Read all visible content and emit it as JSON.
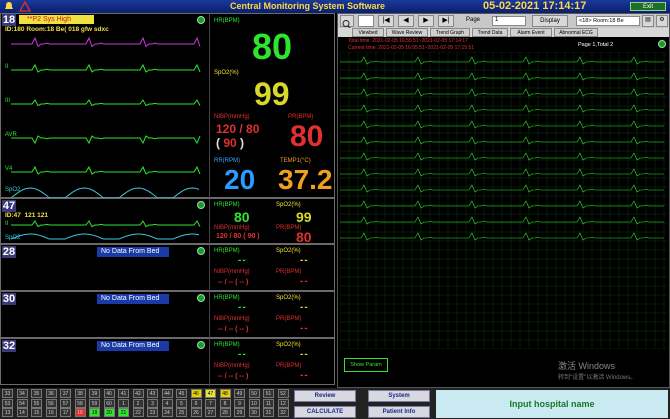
{
  "topbar": {
    "title": "Central Monitoring System Software",
    "datetime": "05-02-2021 17:14:17",
    "exit": "Exit"
  },
  "beds": [
    {
      "number": "18",
      "alarm": "**P2 Sys High",
      "info": "ID:180 Room:18 Be(",
      "name": "018 gfw sdxc",
      "leads": [
        "II",
        "III",
        "AVR",
        "V4"
      ],
      "spo2_wave": "SpO2",
      "hr_label": "HR(BPM)",
      "hr": "80",
      "spo2_label": "SpO2(%)",
      "spo2": "99",
      "nibp_label": "NIBP(mmHg)",
      "nibp_sys": "120",
      "nibp_dia": "80",
      "nibp_map": "90",
      "pr_label": "PR(BPM)",
      "pr": "80",
      "rr_label": "RR(RPM)",
      "rr": "20",
      "temp_label": "TEMP1(°C)",
      "temp": "37.2"
    },
    {
      "number": "47",
      "info": "ID:47",
      "name": "121 121",
      "lead": "II",
      "spo2_wave": "SpO2",
      "hr_label": "HR(BPM)",
      "hr": "80",
      "spo2_label": "SpO2(%)",
      "spo2": "99",
      "nibp_label": "NIBP(mmHg)",
      "nibp_sys": "120",
      "nibp_dia": "80",
      "nibp_map": "90",
      "pr_label": "PR(BPM)",
      "pr": "80"
    },
    {
      "number": "28",
      "nodata": "No Data From Bed",
      "hr_label": "HR(BPM)",
      "spo2_label": "SpO2(%)",
      "nibp_label": "NIBP(mmHg)",
      "pr_label": "PR(BPM)"
    },
    {
      "number": "30",
      "nodata": "No Data From Bed",
      "hr_label": "HR(BPM)",
      "spo2_label": "SpO2(%)",
      "nibp_label": "NIBP(mmHg)",
      "pr_label": "PR(BPM)"
    },
    {
      "number": "32",
      "nodata": "No Data From Bed",
      "hr_label": "HR(BPM)",
      "spo2_label": "SpO2(%)",
      "nibp_label": "NIBP(mmHg)",
      "pr_label": "PR(BPM)"
    }
  ],
  "review": {
    "page_label": "Page",
    "page_value": "1",
    "display_label": "Display",
    "room_select": "<18> Room:18 Be",
    "tabs": [
      "Viewbed",
      "Wave Review",
      "Trend Graph",
      "Trend Data",
      "Alarm Event",
      "Abnormal ECG"
    ],
    "total_time": "Total time: 2021-02-05 16:55:51~2021-02-05 17:14:17",
    "current_time": "Current time: 2021-02-05 16:55:51~2021-02-05 17:15:51",
    "page_info": "Page 1,Total 2",
    "show_param": "Show Param"
  },
  "watermark": {
    "line1": "激活 Windows",
    "line2": "转到\"设置\"以激活 Windows。"
  },
  "bottom": {
    "grid": [
      "33",
      "34",
      "35",
      "36",
      "37",
      "38",
      "39",
      "40",
      "41",
      "42",
      "43",
      "44",
      "45",
      "46",
      "47",
      "48",
      "49",
      "50",
      "51",
      "52",
      "53",
      "54",
      "55",
      "56",
      "57",
      "58",
      "59",
      "60",
      "1",
      "2",
      "3",
      "4",
      "5",
      "6",
      "7",
      "8",
      "9",
      "10",
      "11",
      "12",
      "13",
      "14",
      "15",
      "16",
      "17",
      "18",
      "19",
      "20",
      "21",
      "22",
      "23",
      "24",
      "25",
      "26",
      "27",
      "28",
      "29",
      "30",
      "31",
      "32"
    ],
    "review": "Review",
    "system": "System",
    "calculate": "CALCULATE",
    "patient_info": "Patient Info",
    "hospital": "Input hospital name"
  },
  "colors": {
    "hr": "#2ee52e",
    "spo2": "#d8d82a",
    "nibp": "#e03030",
    "rr": "#2a9cff",
    "temp": "#f0a020",
    "ecg": "#2ee52e",
    "spo2_wave": "#3ac8d8"
  }
}
